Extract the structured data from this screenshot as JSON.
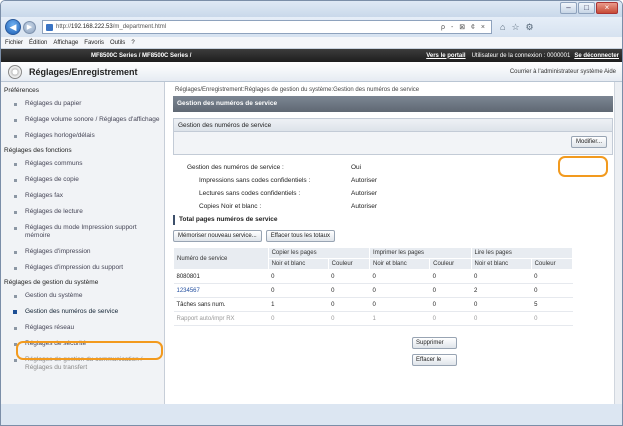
{
  "browser": {
    "url_prefix": "http://",
    "url_host": "192.168.222.53",
    "url_path": "/m_department.html",
    "url_tools": "ρ - ⊠ ¢ ×",
    "window_min": "–",
    "window_max": "□",
    "window_close": "×",
    "back_glyph": "◀",
    "forward_glyph": "▶",
    "home_glyph": "⌂",
    "star_glyph": "☆",
    "tools_glyph": "⚙"
  },
  "menu": [
    "Fichier",
    "Édition",
    "Affichage",
    "Favoris",
    "Outils",
    "?"
  ],
  "header": {
    "device": "MF8500C Series / MF8500C Series /",
    "portal": "Vers le portail",
    "user": "Utilisateur de la connexion : 0000001",
    "logout": "Se déconnecter"
  },
  "app": {
    "title": "Réglages/Enregistrement",
    "links": "Courrier à l'administrateur système  Aide"
  },
  "sidebar": {
    "sections": [
      {
        "label": "Préférences",
        "items": [
          {
            "label": "Réglages du papier"
          },
          {
            "label": "Réglage volume sonore / Réglages d'affichage"
          },
          {
            "label": "Réglages horloge/délais"
          }
        ]
      },
      {
        "label": "Réglages des fonctions",
        "items": [
          {
            "label": "Réglages communs"
          },
          {
            "label": "Réglages de copie"
          },
          {
            "label": "Réglages fax"
          },
          {
            "label": "Réglages de lecture"
          },
          {
            "label": "Réglages du mode Impression support mémoire"
          },
          {
            "label": "Réglages d'impression"
          },
          {
            "label": "Réglages d'impression du support"
          }
        ]
      },
      {
        "label": "Réglages de gestion du système",
        "items": [
          {
            "label": "Gestion du système"
          },
          {
            "label": "Gestion des numéros de service"
          },
          {
            "label": "Réglages réseau"
          },
          {
            "label": "Réglages de sécurité"
          },
          {
            "label": "Réglages de gestion du communication / Réglages du transfert"
          }
        ]
      }
    ]
  },
  "main": {
    "breadcrumb": "Réglages/Enregistrement:Réglages de gestion du système:Gestion des numéros de service",
    "page_title": "Gestion des numéros de service",
    "panel_title": "Gestion des numéros de service",
    "modify_button": "Modifier...",
    "info": [
      {
        "label": "Gestion des numéros de service :",
        "value": "Oui",
        "indent": false
      },
      {
        "label": "Impressions sans codes confidentiels :",
        "value": "Autoriser",
        "indent": true
      },
      {
        "label": "Lectures sans codes confidentiels :",
        "value": "Autoriser",
        "indent": true
      },
      {
        "label": "Copies Noir et blanc :",
        "value": "Autoriser",
        "indent": true
      }
    ],
    "total_title": "Total pages numéros de service",
    "memorize_button": "Mémoriser nouveau service...",
    "clear_all_button": "Effacer tous les totaux",
    "table": {
      "col_service": "Numéro de service",
      "groups": [
        "Copier les pages",
        "Imprimer les pages",
        "Lire les pages"
      ],
      "sub": [
        "Noir et blanc",
        "Couleur",
        "Noir et blanc",
        "Couleur",
        "Noir et blanc",
        "Couleur"
      ],
      "rows": [
        {
          "service": "8080801",
          "values": [
            "0",
            "0",
            "0",
            "0",
            "0",
            "0"
          ],
          "link": false,
          "dim": false
        },
        {
          "service": "1234567",
          "values": [
            "0",
            "0",
            "0",
            "0",
            "2",
            "0"
          ],
          "link": true,
          "dim": false
        },
        {
          "service": "Tâches sans num.",
          "values": [
            "1",
            "0",
            "0",
            "0",
            "0",
            "5"
          ],
          "link": false,
          "dim": false
        },
        {
          "service": "Rapport auto/impr RX",
          "values": [
            "0",
            "0",
            "1",
            "0",
            "0",
            "0"
          ],
          "link": false,
          "dim": true
        }
      ]
    },
    "row_buttons": {
      "delete": "Supprimer",
      "clear": "Effacer le"
    }
  }
}
